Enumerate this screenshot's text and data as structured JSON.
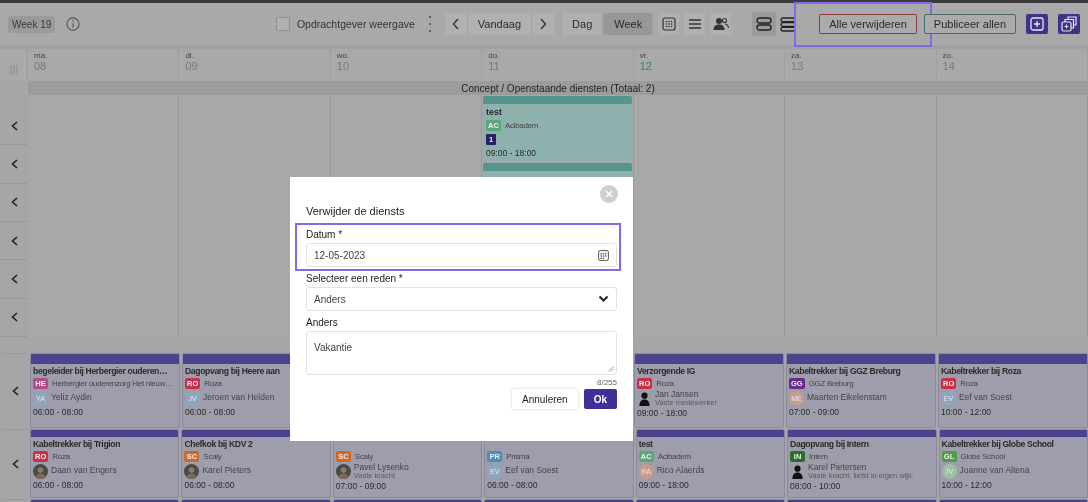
{
  "toolbar": {
    "week_badge": "Week 19",
    "client_view": {
      "label": "Opdrachtgever weergave",
      "checked": false
    },
    "today": "Vandaag",
    "views": [
      {
        "label": "Dag",
        "selected": false
      },
      {
        "label": "Week",
        "selected": true
      }
    ],
    "layouts": [
      {
        "kind": "two-rows",
        "selected": true
      },
      {
        "kind": "three-rows",
        "selected": false
      }
    ],
    "actions": [
      {
        "label": "Alle verwijderen",
        "kind": "danger",
        "highlighted": true
      },
      {
        "label": "Publiceer allen",
        "kind": "publish",
        "highlighted": false
      }
    ]
  },
  "days": [
    {
      "abbr": "ma.",
      "num": "08",
      "today": false
    },
    {
      "abbr": "di.",
      "num": "09",
      "today": false
    },
    {
      "abbr": "wo.",
      "num": "10",
      "today": false
    },
    {
      "abbr": "do.",
      "num": "11",
      "today": false
    },
    {
      "abbr": "vr.",
      "num": "12",
      "today": true
    },
    {
      "abbr": "za.",
      "num": "13",
      "today": false
    },
    {
      "abbr": "zo.",
      "num": "14",
      "today": false
    }
  ],
  "concept": {
    "title": "Concept / Openstaande diensten (Totaal: 2)",
    "columns": [
      [],
      [],
      [],
      [
        {
          "title": "test",
          "client": {
            "code": "AC",
            "name": "Acibadem",
            "color": "#5aa87a"
          },
          "count": "1",
          "time": "09:00 - 18:00"
        },
        null
      ],
      [],
      [],
      []
    ]
  },
  "shift_rows": [
    [
      {
        "title": "begeleider bij Herbergier ouderen…",
        "client": {
          "code": "HE",
          "name": "Herbergier ouderenzorg Het nieuw…",
          "color": "#b04c86"
        },
        "person": {
          "kind": "initials",
          "initials": "YA",
          "color": "#8ea6bd",
          "name": "Yeliz Aydin"
        },
        "time": "06:00 - 08:00"
      },
      {
        "title": "Dagopvang bij Heere aan",
        "client": {
          "code": "RO",
          "name": "Roza",
          "color": "#c8304a"
        },
        "person": {
          "kind": "initials",
          "initials": "JV",
          "color": "#8ea6bd",
          "name": "Jeroen van Helden"
        },
        "time": "06:00 - 08:00"
      },
      null,
      null,
      {
        "title": "Verzorgende IG",
        "client": {
          "code": "RO",
          "name": "Roza",
          "color": "#c8304a"
        },
        "person": {
          "kind": "silhouette",
          "name": "Jan Jansen",
          "note": "Vaste medewerker"
        },
        "time": "09:00 - 18:00"
      },
      {
        "title": "Kabeltrekker bij GGZ Breburg",
        "client": {
          "code": "GG",
          "name": "GGZ Breburg",
          "color": "#6a2a8a"
        },
        "person": {
          "kind": "initials",
          "initials": "ME",
          "color": "#c99a8e",
          "name": "Maarten Eikelenstam"
        },
        "time": "07:00 - 09:00"
      },
      {
        "title": "Kabeltrekker bij Roza",
        "client": {
          "code": "RO",
          "name": "Roza",
          "color": "#c8304a"
        },
        "person": {
          "kind": "initials",
          "initials": "EV",
          "color": "#8ea6bd",
          "name": "Eef van Soest"
        },
        "time": "10:00 - 12:00"
      }
    ],
    [
      {
        "title": "Kabeltrekker bij Trigion",
        "client": {
          "code": "RO",
          "name": "Roza",
          "color": "#c8304a"
        },
        "person": {
          "kind": "photo",
          "name": "Daan van Engers"
        },
        "time": "06:00 - 08:00"
      },
      {
        "title": "Chefkok bij KDV 2",
        "client": {
          "code": "SC",
          "name": "Scaly",
          "color": "#cc6a2c"
        },
        "person": {
          "kind": "photo",
          "name": "Karel Pieters"
        },
        "time": "06:00 - 08:00"
      },
      {
        "client": {
          "code": "SC",
          "name": "Scaly",
          "color": "#cc6a2c"
        },
        "person": {
          "kind": "photo",
          "name": "Pavel Lysenko",
          "note": "Vaste kracht"
        },
        "time": "07:00 - 09:00"
      },
      {
        "client": {
          "code": "PR",
          "name": "Prisma",
          "color": "#4a8cbc"
        },
        "person": {
          "kind": "initials",
          "initials": "EV",
          "color": "#8ea6bd",
          "name": "Eef van Soest"
        },
        "time": "06:00 - 08:00"
      },
      {
        "title": "test",
        "client": {
          "code": "AC",
          "name": "Acibadem",
          "color": "#5aa87a"
        },
        "person": {
          "kind": "initials",
          "initials": "RA",
          "color": "#c99a8e",
          "name": "Rico Alaerds"
        },
        "time": "09:00 - 18:00"
      },
      {
        "title": "Dagopvang bij Intern",
        "client": {
          "code": "IN",
          "name": "Intern",
          "color": "#2a6e2a"
        },
        "person": {
          "kind": "silhouette",
          "name": "Karel Pietersen",
          "note": "Vaste kracht, liefst in eigen wijk."
        },
        "time": "08:00 - 10:00"
      },
      {
        "title": "Kabeltrekker bij Globe School",
        "client": {
          "code": "GL",
          "name": "Globe School",
          "color": "#4a9e48"
        },
        "person": {
          "kind": "initials",
          "initials": "JV",
          "color": "#9ebfa6",
          "name": "Joanne van Altena"
        },
        "time": "10:00 - 12:00"
      }
    ],
    [
      {
        "kind": "stub"
      },
      {
        "kind": "stub"
      },
      {
        "kind": "stub"
      },
      {
        "kind": "stub"
      },
      {
        "kind": "stub"
      },
      {
        "kind": "stub"
      },
      {
        "kind": "stub"
      }
    ]
  ],
  "dialog": {
    "title": "Verwijder de diensts",
    "date": {
      "label": "Datum *",
      "value": "12-05-2023",
      "highlighted": true
    },
    "reason": {
      "label": "Selecteer een reden *",
      "value": "Anders"
    },
    "other": {
      "label": "Anders",
      "value": "Vakantie",
      "counter": "8/255"
    },
    "buttons": [
      {
        "label": "Annuleren",
        "kind": "secondary"
      },
      {
        "label": "Ok",
        "kind": "primary"
      }
    ]
  }
}
